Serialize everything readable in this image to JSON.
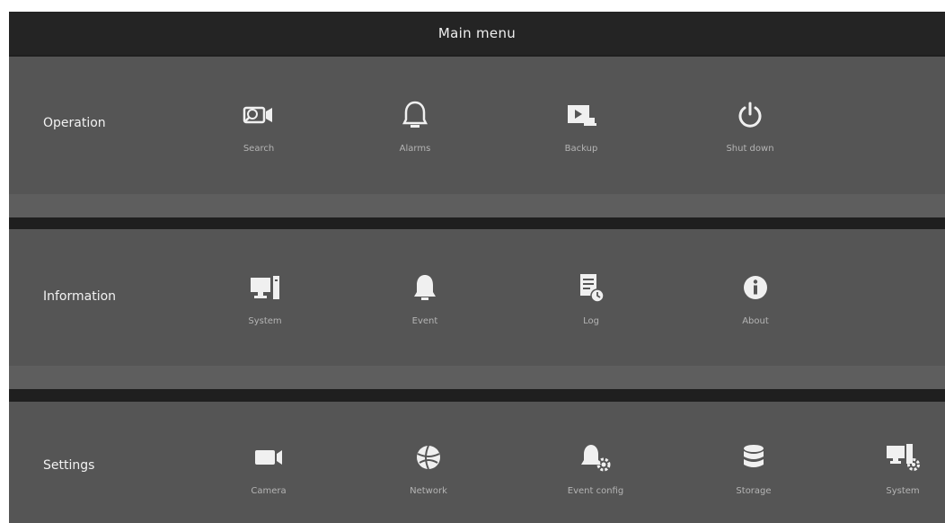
{
  "window": {
    "title": "Main menu"
  },
  "sections": [
    {
      "label": "Operation",
      "items": [
        {
          "label": "Search",
          "icon": "search-camera-icon"
        },
        {
          "label": "Alarms",
          "icon": "bell-icon"
        },
        {
          "label": "Backup",
          "icon": "backup-icon"
        },
        {
          "label": "Shut down",
          "icon": "power-icon"
        }
      ]
    },
    {
      "label": "Information",
      "items": [
        {
          "label": "System",
          "icon": "computer-icon"
        },
        {
          "label": "Event",
          "icon": "bell-icon"
        },
        {
          "label": "Log",
          "icon": "log-icon"
        },
        {
          "label": "About",
          "icon": "info-icon"
        }
      ]
    },
    {
      "label": "Settings",
      "items": [
        {
          "label": "Camera",
          "icon": "camera-icon"
        },
        {
          "label": "Network",
          "icon": "network-globe-icon"
        },
        {
          "label": "Event config",
          "icon": "bell-gear-icon"
        },
        {
          "label": "Storage",
          "icon": "database-icon"
        },
        {
          "label": "System",
          "icon": "computer-gear-icon"
        }
      ]
    }
  ],
  "colors": {
    "background": "#1f1f1f",
    "section": "#555555",
    "icon": "#f0f0f0",
    "label": "#b4b4b4"
  }
}
